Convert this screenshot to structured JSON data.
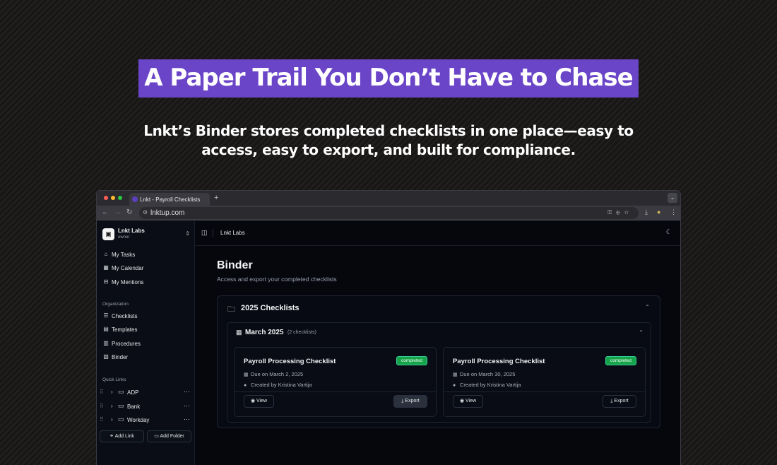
{
  "hero": {
    "headline": "A Paper Trail You Don’t Have to Chase",
    "subhead": "Lnkt’s Binder stores completed checklists in one place—easy to access, easy to export, and built for compliance."
  },
  "browser": {
    "tab_title": "Lnkt - Payroll Checklists",
    "new_tab": "+",
    "url": "lnktup.com"
  },
  "sidebar": {
    "org_name": "Lnkt Labs",
    "org_role": "owner",
    "nav": [
      {
        "label": "My Tasks",
        "icon": "home-icon"
      },
      {
        "label": "My Calendar",
        "icon": "calendar-icon"
      },
      {
        "label": "My Mentions",
        "icon": "inbox-icon"
      }
    ],
    "organization_label": "Organization",
    "org_nav": [
      {
        "label": "Checklists",
        "icon": "list-check-icon"
      },
      {
        "label": "Templates",
        "icon": "template-icon"
      },
      {
        "label": "Procedures",
        "icon": "book-icon"
      },
      {
        "label": "Binder",
        "icon": "binder-icon"
      }
    ],
    "quick_links_label": "Quick Links",
    "quick_links": [
      {
        "label": "ADP"
      },
      {
        "label": "Bank"
      },
      {
        "label": "Workday"
      }
    ],
    "add_link": "Add Link",
    "add_folder": "Add Folder"
  },
  "topbar": {
    "breadcrumb": "Lnkt Labs"
  },
  "binder": {
    "title": "Binder",
    "subtitle": "Access and export your completed checklists",
    "year_group": "2025 Checklists",
    "month_group": "March 2025",
    "month_count": "(2 checklists)",
    "checklists": [
      {
        "title": "Payroll Processing Checklist",
        "status": "completed",
        "due": "Due on March 2, 2025",
        "created_by": "Created by Kristina Vartija",
        "view_label": "View",
        "export_label": "Export"
      },
      {
        "title": "Payroll Processing Checklist",
        "status": "completed",
        "due": "Due on March 30, 2025",
        "created_by": "Created by Kristina Vartija",
        "view_label": "View",
        "export_label": "Export"
      }
    ]
  },
  "colors": {
    "accent_purple": "#6b45c8",
    "status_green": "#16a34a",
    "app_bg": "#05070d"
  }
}
